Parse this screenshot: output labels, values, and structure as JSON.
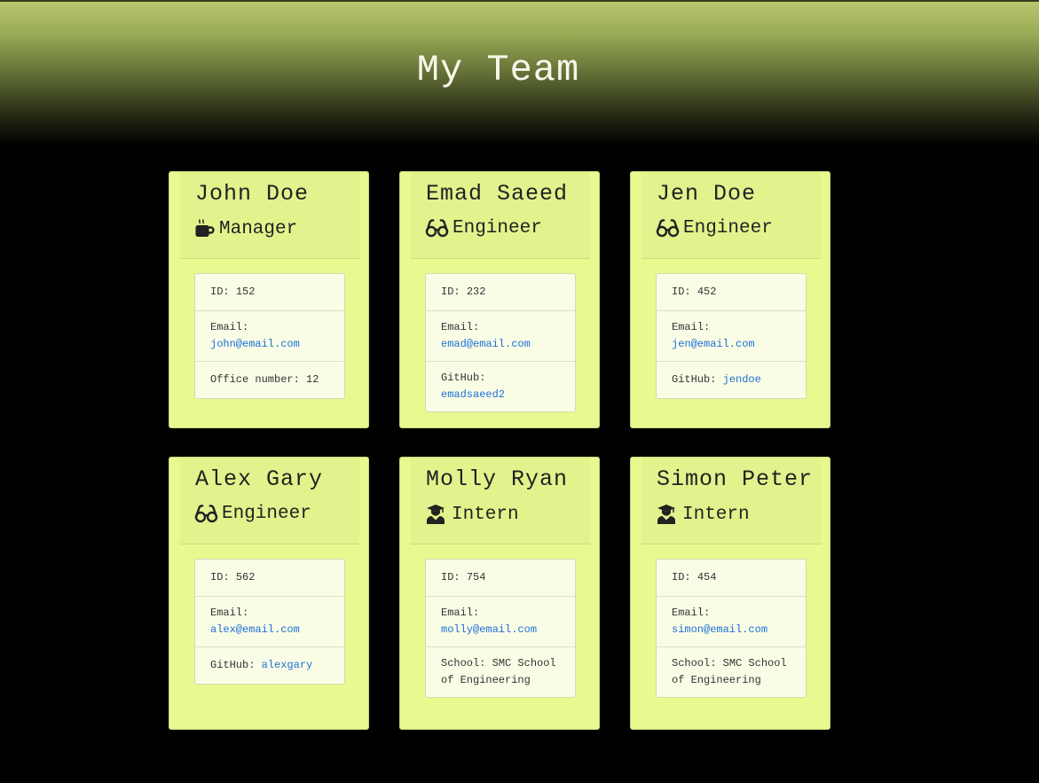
{
  "page": {
    "title": "My Team"
  },
  "colors": {
    "card_bg": "#e8f990",
    "card_header_bg": "#e1f38c",
    "list_bg": "#fafde6",
    "link": "#1a6fd8"
  },
  "labels": {
    "id": "ID:",
    "email": "Email:",
    "office": "Office number:",
    "github": "GitHub:",
    "school": "School:"
  },
  "team": [
    {
      "name": "John Doe",
      "role": "Manager",
      "icon": "coffee-icon",
      "id": "152",
      "email": "john@email.com",
      "office": "12"
    },
    {
      "name": "Emad Saeed",
      "role": "Engineer",
      "icon": "glasses-icon",
      "id": "232",
      "email": "emad@email.com",
      "github": "emadsaeed2"
    },
    {
      "name": "Jen Doe",
      "role": "Engineer",
      "icon": "glasses-icon",
      "id": "452",
      "email": "jen@email.com",
      "github": "jendoe"
    },
    {
      "name": "Alex Gary",
      "role": "Engineer",
      "icon": "glasses-icon",
      "id": "562",
      "email": "alex@email.com",
      "github": "alexgary"
    },
    {
      "name": "Molly Ryan",
      "role": "Intern",
      "icon": "graduate-icon",
      "id": "754",
      "email": "molly@email.com",
      "school": "SMC School of Engineering"
    },
    {
      "name": "Simon Peter",
      "role": "Intern",
      "icon": "graduate-icon",
      "id": "454",
      "email": "simon@email.com",
      "school": "SMC School of Engineering"
    }
  ]
}
